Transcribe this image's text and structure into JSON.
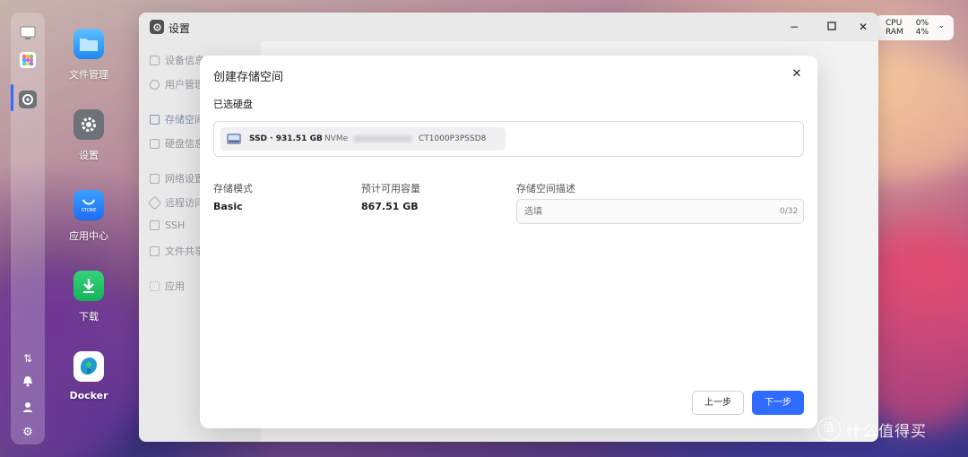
{
  "desktop": {
    "apps": [
      {
        "label": "文件管理",
        "icon": "folder-icon"
      },
      {
        "label": "设置",
        "icon": "gear-icon"
      },
      {
        "label": "应用中心",
        "icon": "store-icon",
        "badge": "STORE"
      },
      {
        "label": "下载",
        "icon": "download-icon"
      },
      {
        "label": "Docker",
        "icon": "docker-icon"
      }
    ]
  },
  "dock": {
    "icons": [
      "monitor-icon",
      "apps-grid-icon",
      "settings-icon"
    ],
    "bottom_icons": [
      "sync-icon",
      "bell-icon",
      "user-icon",
      "gear-icon"
    ]
  },
  "system_monitor": {
    "cpu_label": "CPU",
    "cpu_value": "0%",
    "ram_label": "RAM",
    "ram_value": "4%"
  },
  "settings_window": {
    "title": "设置",
    "sidebar": [
      {
        "label": "设备信息"
      },
      {
        "label": "用户管理"
      },
      {
        "label": "存储空间",
        "selected": true
      },
      {
        "label": "硬盘信息"
      },
      {
        "label": "网络设置"
      },
      {
        "label": "远程访问"
      },
      {
        "label": "SSH"
      },
      {
        "label": "文件共享"
      },
      {
        "label": "应用"
      }
    ]
  },
  "modal": {
    "title": "创建存储空间",
    "selected_disks_label": "已选硬盘",
    "disk": {
      "size": "SSD · 931.51 GB",
      "interface": "NVMe",
      "model": "CT1000P3PSSD8"
    },
    "storage_mode_label": "存储模式",
    "storage_mode_value": "Basic",
    "capacity_label": "预计可用容量",
    "capacity_value": "867.51 GB",
    "description_label": "存储空间描述",
    "description_placeholder": "选填",
    "description_counter": "0/32",
    "prev_button": "上一步",
    "next_button": "下一步"
  },
  "watermark": {
    "symbol": "值",
    "text": "什么值得买"
  },
  "colors": {
    "accent": "#2f6bff",
    "window_bg": "#ffffff",
    "sidebar_bg": "#f6f6f7"
  }
}
